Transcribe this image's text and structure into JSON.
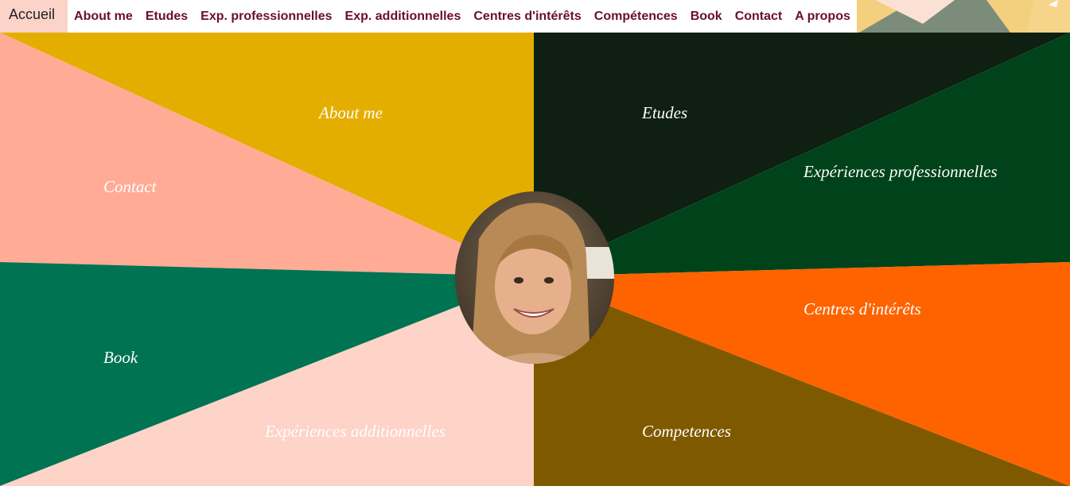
{
  "nav": {
    "home": "Accueil",
    "items": [
      "About me",
      "Etudes",
      "Exp. professionnelles",
      "Exp. additionnelles",
      "Centres d'intérêts",
      "Compétences",
      "Book",
      "Contact",
      "A propos"
    ]
  },
  "sections": {
    "about": "About me",
    "etudes": "Etudes",
    "exp_pro": "Expériences professionnelles",
    "contact": "Contact",
    "centres": "Centres d'intérêts",
    "book": "Book",
    "exp_add": "Expériences additionnelles",
    "competences": "Competences"
  },
  "colors": {
    "about": "#e4ae00",
    "contact": "#ffab95",
    "etudes": "#0f2013",
    "exp_pro": "#00431a",
    "book": "#007352",
    "exp_add": "#fed3c8",
    "competences": "#7f5900",
    "centres": "#fe6300",
    "nav_text": "#6b0f2a"
  },
  "avatar": {
    "icon": "profile-photo"
  }
}
